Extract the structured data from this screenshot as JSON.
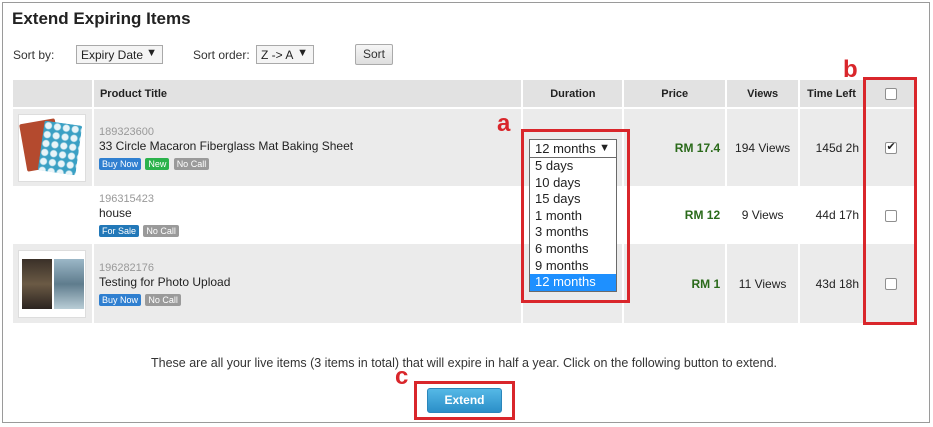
{
  "page": {
    "title": "Extend Expiring Items"
  },
  "sort": {
    "sort_by_label": "Sort by:",
    "sort_by_value": "Expiry Date",
    "sort_order_label": "Sort order:",
    "sort_order_value": "Z -> A",
    "sort_button": "Sort"
  },
  "table": {
    "headers": {
      "product_title": "Product Title",
      "duration": "Duration",
      "price": "Price",
      "views": "Views",
      "time_left": "Time Left"
    },
    "rows": [
      {
        "id": "189323600",
        "title": "33 Circle Macaron Fiberglass Mat Baking Sheet",
        "badges": [
          "Buy Now",
          "New",
          "No Call"
        ],
        "price": "RM 17.4",
        "views": "194 Views",
        "time_left": "145d 2h",
        "checked": true
      },
      {
        "id": "196315423",
        "title": "house",
        "badges": [
          "For Sale",
          "No Call"
        ],
        "price": "RM 12",
        "views": "9 Views",
        "time_left": "44d 17h",
        "checked": false
      },
      {
        "id": "196282176",
        "title": "Testing for Photo Upload",
        "badges": [
          "Buy Now",
          "No Call"
        ],
        "price": "RM 1",
        "views": "11 Views",
        "time_left": "43d 18h",
        "checked": false
      }
    ]
  },
  "duration_dropdown": {
    "selected": "12 months",
    "options": [
      "5 days",
      "10 days",
      "15 days",
      "1 month",
      "3 months",
      "6 months",
      "9 months",
      "12 months"
    ]
  },
  "annotations": {
    "a": "a",
    "b": "b",
    "c": "c"
  },
  "footer": {
    "info": "These are all your live items (3 items in total) that will expire in half a year. Click on the following button to extend.",
    "extend_button": "Extend"
  },
  "colors": {
    "annotation_red": "#d9262b",
    "extend_button": "#2b8fc8",
    "price_green": "#2a6a1a"
  }
}
